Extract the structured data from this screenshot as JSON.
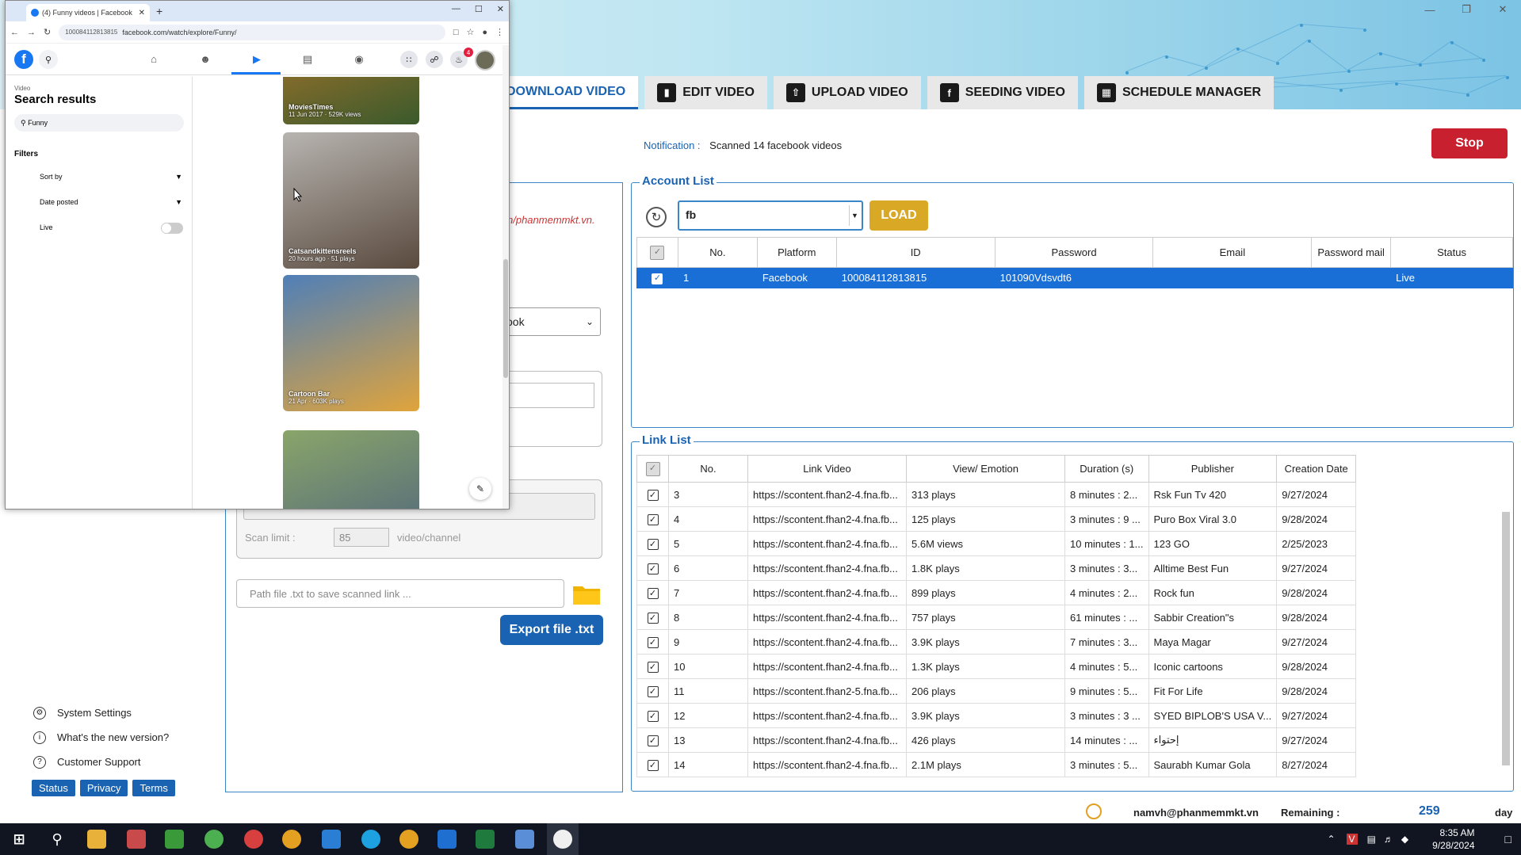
{
  "app": {
    "tabs": [
      {
        "label": "DOWNLOAD VIDEO",
        "icon": "download-icon"
      },
      {
        "label": "EDIT VIDEO",
        "icon": "film-icon"
      },
      {
        "label": "UPLOAD VIDEO",
        "icon": "upload-icon"
      },
      {
        "label": "SEEDING VIDEO",
        "icon": "facebook-icon"
      },
      {
        "label": "SCHEDULE MANAGER",
        "icon": "calendar-icon"
      }
    ],
    "notification_label": "Notification :",
    "notification_text": "Scanned 14 facebook videos",
    "stop_label": "Stop",
    "left_panel": {
      "url_fragment": "n/phanmemmkt.vn.",
      "platform_select": "ook",
      "scan_limit_label": "Scan limit :",
      "scan_limit_value": "85",
      "scan_limit_unit": "video/channel",
      "path_placeholder": "Path file .txt to save scanned link ...",
      "export_label": "Export file .txt"
    },
    "side_menu": [
      {
        "label": "System Settings",
        "icon": "gear-icon"
      },
      {
        "label": "What's the new version?",
        "icon": "info-icon"
      },
      {
        "label": "Customer Support",
        "icon": "help-icon"
      }
    ],
    "side_links": [
      "Status",
      "Privacy",
      "Terms"
    ],
    "account_list": {
      "title": "Account List",
      "search_value": "fb",
      "load_label": "LOAD",
      "columns": [
        "No.",
        "Platform",
        "ID",
        "Password",
        "Email",
        "Password mail",
        "Status"
      ],
      "rows": [
        {
          "checked": true,
          "no": "1",
          "platform": "Facebook",
          "id": "100084112813815",
          "password": "101090Vdsvdt6",
          "email": "",
          "password_mail": "",
          "status": "Live"
        }
      ]
    },
    "link_list": {
      "title": "Link List",
      "columns": [
        "No.",
        "Link Video",
        "View/ Emotion",
        "Duration (s)",
        "Publisher",
        "Creation Date"
      ],
      "rows": [
        {
          "no": "3",
          "link": "https://scontent.fhan2-4.fna.fb...",
          "views": "313 plays",
          "duration": "8 minutes : 2...",
          "publisher": "Rsk Fun Tv 420",
          "date": "9/27/2024"
        },
        {
          "no": "4",
          "link": "https://scontent.fhan2-4.fna.fb...",
          "views": "125 plays",
          "duration": "3 minutes : 9 ...",
          "publisher": "Puro Box Viral 3.0",
          "date": "9/28/2024"
        },
        {
          "no": "5",
          "link": "https://scontent.fhan2-4.fna.fb...",
          "views": "5.6M views",
          "duration": "10 minutes : 1...",
          "publisher": "123 GO",
          "date": "2/25/2023"
        },
        {
          "no": "6",
          "link": "https://scontent.fhan2-4.fna.fb...",
          "views": "1.8K plays",
          "duration": "3 minutes : 3...",
          "publisher": "Alltime Best Fun",
          "date": "9/27/2024"
        },
        {
          "no": "7",
          "link": "https://scontent.fhan2-4.fna.fb...",
          "views": "899 plays",
          "duration": "4 minutes : 2...",
          "publisher": "Rock fun",
          "date": "9/28/2024"
        },
        {
          "no": "8",
          "link": "https://scontent.fhan2-4.fna.fb...",
          "views": "757 plays",
          "duration": "61 minutes : ...",
          "publisher": "Sabbir Creation\"s",
          "date": "9/28/2024"
        },
        {
          "no": "9",
          "link": "https://scontent.fhan2-4.fna.fb...",
          "views": "3.9K plays",
          "duration": "7 minutes : 3...",
          "publisher": "Maya Magar",
          "date": "9/27/2024"
        },
        {
          "no": "10",
          "link": "https://scontent.fhan2-4.fna.fb...",
          "views": "1.3K plays",
          "duration": "4 minutes : 5...",
          "publisher": "Iconic cartoons",
          "date": "9/28/2024"
        },
        {
          "no": "11",
          "link": "https://scontent.fhan2-5.fna.fb...",
          "views": "206 plays",
          "duration": "9 minutes : 5...",
          "publisher": "Fit For Life",
          "date": "9/28/2024"
        },
        {
          "no": "12",
          "link": "https://scontent.fhan2-4.fna.fb...",
          "views": "3.9K plays",
          "duration": "3 minutes : 3 ...",
          "publisher": "SYED BIPLOB'S USA V...",
          "date": "9/27/2024"
        },
        {
          "no": "13",
          "link": "https://scontent.fhan2-4.fna.fb...",
          "views": "426 plays",
          "duration": "14 minutes : ...",
          "publisher": "إحتواء",
          "date": "9/27/2024"
        },
        {
          "no": "14",
          "link": "https://scontent.fhan2-4.fna.fb...",
          "views": "2.1M plays",
          "duration": "3 minutes : 5...",
          "publisher": "Saurabh Kumar Gola",
          "date": "8/27/2024"
        }
      ]
    },
    "status_bar": {
      "email": "namvh@phanmemmkt.vn",
      "remaining_label": "Remaining :",
      "remaining_value": "259",
      "remaining_unit": "day"
    }
  },
  "browser": {
    "tab_title": "(4) Funny videos | Facebook",
    "url_id": "100084112813815",
    "url": "facebook.com/watch/explore/Funny/",
    "notification_count": "4",
    "sidebar": {
      "crumb": "Video",
      "title": "Search results",
      "query": "Funny",
      "filters_label": "Filters",
      "filters": [
        "Sort by",
        "Date posted"
      ],
      "live_label": "Live"
    },
    "videos": [
      {
        "channel": "MoviesTimes",
        "info": "11 Jun 2017 · 529K views",
        "color1": "#c47a2a",
        "color2": "#3a5a2c"
      },
      {
        "channel": "Catsandkittensreels",
        "info": "20 hours ago · 51 plays",
        "color1": "#b7b4b0",
        "color2": "#5a4a3e"
      },
      {
        "channel": "Cartoon Bar",
        "info": "21 Apr · 603K plays",
        "color1": "#4f7fb8",
        "color2": "#e0a43c"
      },
      {
        "channel": "",
        "info": "",
        "color1": "#8aa56a",
        "color2": "#4a5f7e"
      }
    ]
  },
  "taskbar": {
    "time": "8:35 AM",
    "date": "9/28/2024"
  }
}
